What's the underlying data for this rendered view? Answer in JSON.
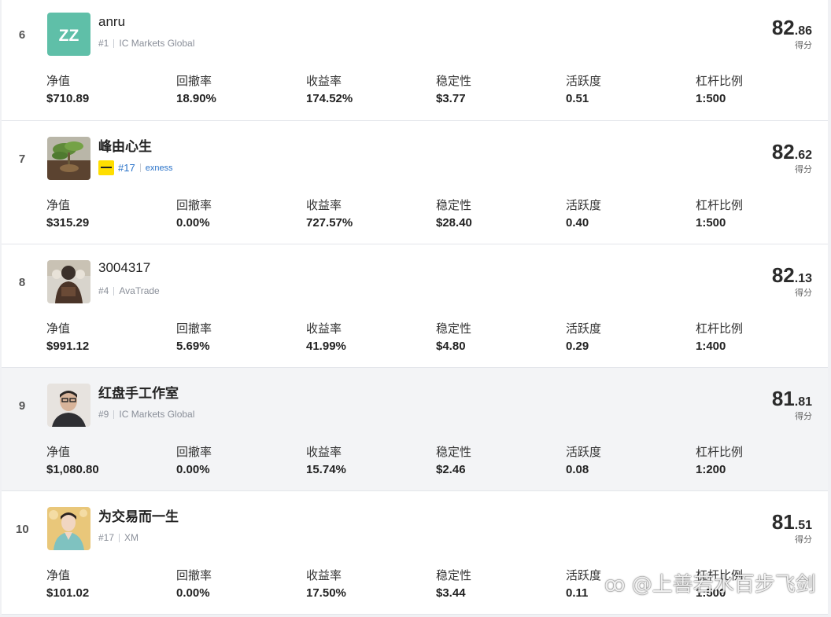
{
  "labels": {
    "score_label": "得分",
    "equity": "净值",
    "drawdown": "回撤率",
    "return": "收益率",
    "stability": "稳定性",
    "activity": "活跃度",
    "leverage": "杠杆比例"
  },
  "rows": [
    {
      "rank": "6",
      "avatar_text": "ZZ",
      "name": "anru",
      "broker_rank": "#1",
      "broker": "IC Markets Global",
      "score_int": "82",
      "score_dec": ".86",
      "equity": "$710.89",
      "drawdown": "18.90%",
      "return": "174.52%",
      "stability": "$3.77",
      "activity": "0.51",
      "leverage": "1:500"
    },
    {
      "rank": "7",
      "name": "峰由心生",
      "broker_rank": "#17",
      "broker": "exness",
      "score_int": "82",
      "score_dec": ".62",
      "equity": "$315.29",
      "drawdown": "0.00%",
      "return": "727.57%",
      "stability": "$28.40",
      "activity": "0.40",
      "leverage": "1:500"
    },
    {
      "rank": "8",
      "name": "3004317",
      "broker_rank": "#4",
      "broker": "AvaTrade",
      "score_int": "82",
      "score_dec": ".13",
      "equity": "$991.12",
      "drawdown": "5.69%",
      "return": "41.99%",
      "stability": "$4.80",
      "activity": "0.29",
      "leverage": "1:400"
    },
    {
      "rank": "9",
      "name": "红盘手工作室",
      "broker_rank": "#9",
      "broker": "IC Markets Global",
      "score_int": "81",
      "score_dec": ".81",
      "equity": "$1,080.80",
      "drawdown": "0.00%",
      "return": "15.74%",
      "stability": "$2.46",
      "activity": "0.08",
      "leverage": "1:200"
    },
    {
      "rank": "10",
      "name": "为交易而一生",
      "broker_rank": "#17",
      "broker": "XM",
      "score_int": "81",
      "score_dec": ".51",
      "equity": "$101.02",
      "drawdown": "0.00%",
      "return": "17.50%",
      "stability": "$3.44",
      "activity": "0.11",
      "leverage": "1:500"
    }
  ],
  "colors": {
    "avatar_zz": "#5fbfa8",
    "link_blue": "#2a73c9",
    "highlight_row": "#f3f4f6"
  },
  "watermark": "@上善若水百步飞剑",
  "icons": {
    "exness_logo": "exness-logo-icon",
    "watermark_logo": "weibo-logo-icon"
  }
}
